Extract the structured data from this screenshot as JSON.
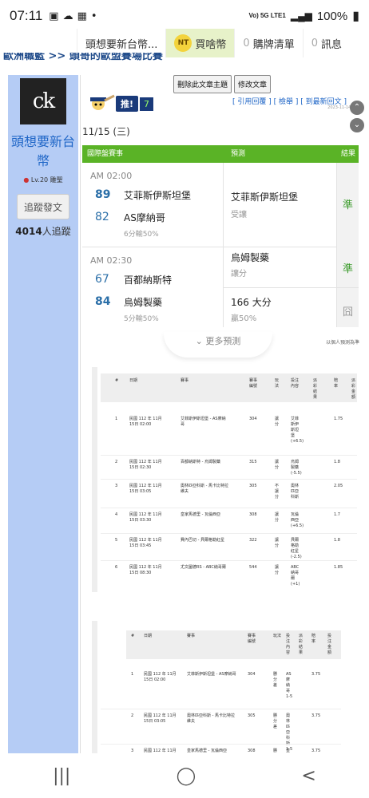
{
  "status_bar": {
    "time": "07:11",
    "network": "Vo) 5G LTE1",
    "battery": "100%"
  },
  "top_nav": {
    "tabs": [
      {
        "label": "頭想要新台幣..."
      },
      {
        "label": "買啥幣",
        "coin": "NT"
      },
      {
        "count": "0",
        "label": "購牌清單"
      },
      {
        "count": "0",
        "label": "訊息"
      }
    ]
  },
  "breadcrumb": "歐洲職籃 >> 頭哥的歐盟賽場比賽",
  "sidebar": {
    "avatar_text": "ck",
    "username": "頭想要新台幣",
    "level": "Lv.20 雕聖",
    "follow_label": "追蹤發文",
    "followers": "4014",
    "followers_suffix": "人追蹤"
  },
  "actions": {
    "delete_topic": "刪除此文章主題",
    "edit_post": "修改文章"
  },
  "links": {
    "quote": "[ 引用回覆 ]",
    "report": "[ 檢舉 ]",
    "latest": "[ 到最新回文 ]"
  },
  "post_time_small": "2023-11-14 1",
  "push": {
    "label": "推!",
    "count": "7"
  },
  "post_date": "11/15 (三)",
  "prediction_table": {
    "headers": {
      "match": "國際盤賽事",
      "predict": "預測",
      "result": "結果"
    },
    "games": [
      {
        "time": "AM 02:00",
        "team1_num": "89",
        "team1": "艾菲斯伊斯坦堡",
        "team2_num": "82",
        "team2": "AS摩納哥",
        "spread": "6分輸50%",
        "pick": "艾菲斯伊斯坦堡",
        "pick_type": "受讓",
        "result": "準"
      },
      {
        "time": "AM 02:30",
        "team1_num": "67",
        "team1": "百都納斯特",
        "team2_num": "84",
        "team2": "烏姆製藥",
        "spread": "5分輸50%",
        "pick1": "烏姆製藥",
        "pick1_type": "讓分",
        "result1": "準",
        "pick2": "166 大分",
        "pick2_type": "贏50%",
        "result2": "囧"
      }
    ]
  },
  "more_label": "更多預測",
  "note": "以個人預測為準",
  "image_table1": {
    "headers": [
      "#",
      "日期",
      "賽事",
      "賽事\n編號",
      "玩\n法",
      "投注\n內容",
      "派\n彩\n結\n果",
      "賠\n率",
      "派\n彩\n金\n額"
    ],
    "rows": [
      [
        "1",
        "民國 112 年 11月\n15日 02:00",
        "艾菲斯伊斯坦堡 - AS摩納\n哥",
        "304",
        "讓\n分",
        "艾菲\n斯伊\n斯坦\n堡\n(+6.5)",
        "",
        "1.75"
      ],
      [
        "2",
        "民國 112 年 11月\n15日 02:30",
        "百都納斯特 - 烏姆製藥",
        "315",
        "讓\n分",
        "烏姆\n製藥\n(-5.5)",
        "",
        "1.8"
      ],
      [
        "3",
        "民國 112 年 11月\n15日 03:05",
        "奧林匹亞科斯 - 馬卡比特拉\n維夫",
        "305",
        "不\n讓\n分",
        "奧林\n匹亞\n科斯",
        "",
        "2.05"
      ],
      [
        "4",
        "民國 112 年 11月\n15日 03:30",
        "皇家馬德里 - 瓦倫西亞",
        "308",
        "讓\n分",
        "瓦倫\n西亞\n(+6.5)",
        "",
        "1.7"
      ],
      [
        "5",
        "民國 112 年 11月\n15日 03:45",
        "費內巴切 - 貝爾格勒紅星",
        "322",
        "讓\n分",
        "貝爾\n格勒\n紅星\n(-2.5)",
        "",
        "1.8"
      ],
      [
        "6",
        "民國 112 年 11月\n15日 08:30",
        "尤文圖德RS - ABC納哥爾",
        "544",
        "讓\n分",
        "ABC\n納哥\n爾\n(+1)",
        "",
        "1.85"
      ]
    ]
  },
  "image_table2": {
    "headers": [
      "#",
      "日期",
      "賽事",
      "賽事\n編號",
      "玩法",
      "投\n注\n內\n容",
      "派\n彩\n結\n果",
      "賠\n率",
      "投\n注\n金\n額"
    ],
    "rows": [
      [
        "1",
        "民國 112 年 11月\n15日 02:00",
        "艾菲斯伊斯坦堡 - AS摩納哥",
        "304",
        "勝\n分\n差",
        "AS\n摩\n納\n哥\n1-5",
        "",
        "3.75"
      ],
      [
        "2",
        "民國 112 年 11月\n15日 03:05",
        "奧林匹亞科斯 - 馬卡比特拉\n維夫",
        "305",
        "勝\n分\n差",
        "奧\n林\n匹\n亞\n科\n斯\n1-5",
        "",
        "3.75"
      ],
      [
        "3",
        "民國 112 年 11月\n15日 03:30",
        "皇家馬德里 - 瓦倫西亞",
        "308",
        "勝\n分",
        "皇\n家\n馬",
        "",
        "3.75"
      ]
    ]
  },
  "android_nav": {
    "recent": "|||",
    "home": "◯",
    "back": "<"
  }
}
